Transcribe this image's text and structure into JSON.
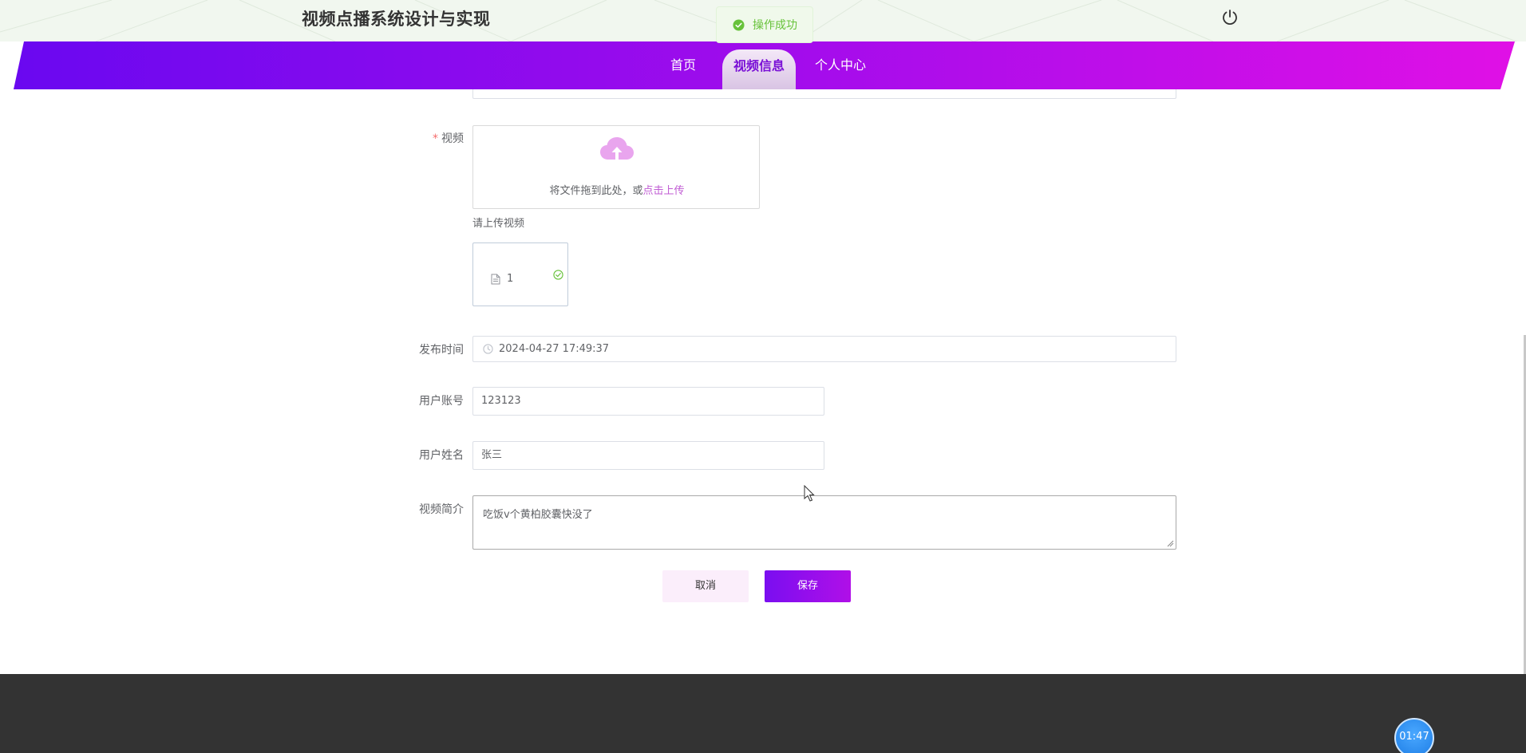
{
  "header": {
    "site_title": "视频点播系统设计与实现"
  },
  "toast": {
    "message": "操作成功"
  },
  "nav": {
    "items": [
      {
        "label": "首页"
      },
      {
        "label": "视频信息"
      },
      {
        "label": "个人中心"
      }
    ],
    "active": "视频信息"
  },
  "form": {
    "video": {
      "label": "视频",
      "required_mark": "*",
      "upload_text": "将文件拖到此处，或",
      "upload_link": "点击上传",
      "tip": "请上传视频",
      "file_name": "1"
    },
    "publish_time": {
      "label": "发布时间",
      "value": "2024-04-27 17:49:37"
    },
    "user_account": {
      "label": "用户账号",
      "value": "123123"
    },
    "user_name": {
      "label": "用户姓名",
      "value": "张三"
    },
    "video_intro": {
      "label": "视频简介",
      "value": "吃饭v个黄柏胶囊快没了"
    },
    "buttons": {
      "cancel": "取消",
      "save": "保存"
    }
  },
  "timer": {
    "value": "01:47"
  },
  "colors": {
    "accent_start": "#7a0ef0",
    "accent_end": "#e010e6",
    "success": "#67c23a",
    "link": "#c05bd3",
    "footer_bg": "#333333"
  },
  "icons": {
    "power": "power-icon",
    "cloud": "cloud-upload-icon",
    "doc": "document-icon",
    "check": "check-circle-icon",
    "clock": "clock-icon",
    "ok": "success-icon"
  }
}
